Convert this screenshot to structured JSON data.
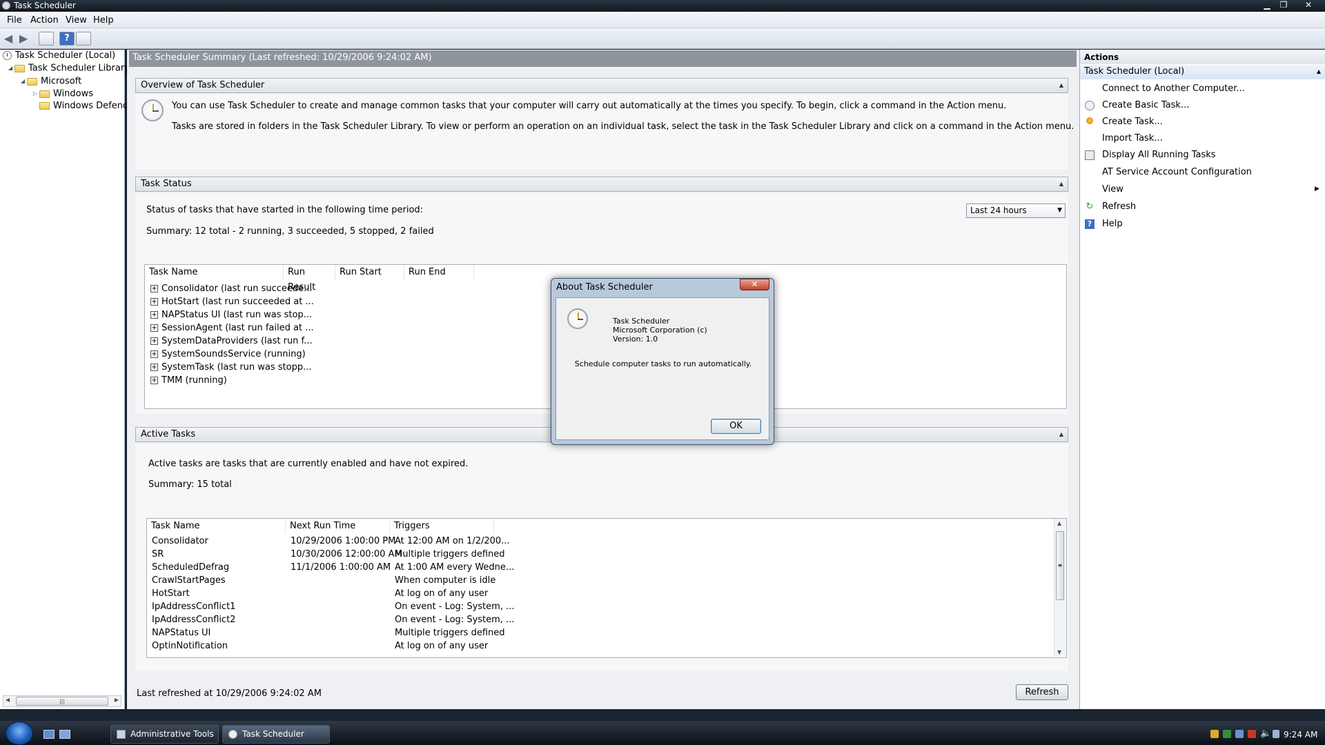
{
  "window": {
    "title": "Task Scheduler"
  },
  "menu": [
    "File",
    "Action",
    "View",
    "Help"
  ],
  "tree": {
    "root": "Task Scheduler (Local)",
    "library": "Task Scheduler Library",
    "microsoft": "Microsoft",
    "windows": "Windows",
    "defender": "Windows Defende"
  },
  "summary_bar": "Task Scheduler Summary (Last refreshed: 10/29/2006 9:24:02 AM)",
  "overview": {
    "header": "Overview of Task Scheduler",
    "line1": "You can use Task Scheduler to create and manage common tasks that your computer will carry out automatically at the times you specify. To begin, click a command in the Action menu.",
    "line2": "Tasks are stored in folders in the Task Scheduler Library. To view or perform an operation on an individual task, select the task in the Task Scheduler Library and click on a command in the Action menu."
  },
  "task_status": {
    "header": "Task Status",
    "period_label": "Status of tasks that have started in the following time period:",
    "period_value": "Last 24 hours",
    "summary": "Summary: 12 total - 2 running, 3 succeeded, 5 stopped, 2 failed",
    "columns": [
      "Task Name",
      "Run Result",
      "Run Start",
      "Run End"
    ],
    "rows": [
      "Consolidator (last run succeede...",
      "HotStart (last run succeeded at ...",
      "NAPStatus UI (last run was stop...",
      "SessionAgent (last run failed at ...",
      "SystemDataProviders (last run f...",
      "SystemSoundsService (running)",
      "SystemTask (last run was stopp...",
      "TMM (running)"
    ]
  },
  "active_tasks": {
    "header": "Active Tasks",
    "description": "Active tasks are tasks that are currently enabled and have not expired.",
    "summary": "Summary: 15 total",
    "columns": [
      "Task Name",
      "Next Run Time",
      "Triggers"
    ],
    "rows": [
      {
        "name": "Consolidator",
        "next": "10/29/2006 1:00:00 PM",
        "trigger": "At 12:00 AM on 1/2/200..."
      },
      {
        "name": "SR",
        "next": "10/30/2006 12:00:00 AM",
        "trigger": "Multiple triggers defined"
      },
      {
        "name": "ScheduledDefrag",
        "next": "11/1/2006 1:00:00 AM",
        "trigger": "At 1:00 AM every Wedne..."
      },
      {
        "name": "CrawlStartPages",
        "next": "",
        "trigger": "When computer is idle"
      },
      {
        "name": "HotStart",
        "next": "",
        "trigger": "At log on of any user"
      },
      {
        "name": "IpAddressConflict1",
        "next": "",
        "trigger": "On event - Log: System, ..."
      },
      {
        "name": "IpAddressConflict2",
        "next": "",
        "trigger": "On event - Log: System, ..."
      },
      {
        "name": "NAPStatus UI",
        "next": "",
        "trigger": "Multiple triggers defined"
      },
      {
        "name": "OptinNotification",
        "next": "",
        "trigger": "At log on of any user"
      }
    ]
  },
  "footer": {
    "last_refreshed": "Last refreshed at 10/29/2006 9:24:02 AM",
    "refresh_button": "Refresh"
  },
  "actions": {
    "header": "Actions",
    "subheader": "Task Scheduler (Local)",
    "items": [
      "Connect to Another Computer...",
      "Create Basic Task...",
      "Create Task...",
      "Import Task...",
      "Display All Running Tasks",
      "AT Service Account Configuration",
      "View",
      "Refresh",
      "Help"
    ]
  },
  "dialog": {
    "title": "About Task Scheduler",
    "product": "Task Scheduler",
    "company": "Microsoft Corporation (c)",
    "version": "Version: 1.0",
    "description": "Schedule computer tasks to run automatically.",
    "ok": "OK"
  },
  "taskbar": {
    "items": [
      "Administrative Tools",
      "Task Scheduler"
    ],
    "time": "9:24 AM"
  }
}
